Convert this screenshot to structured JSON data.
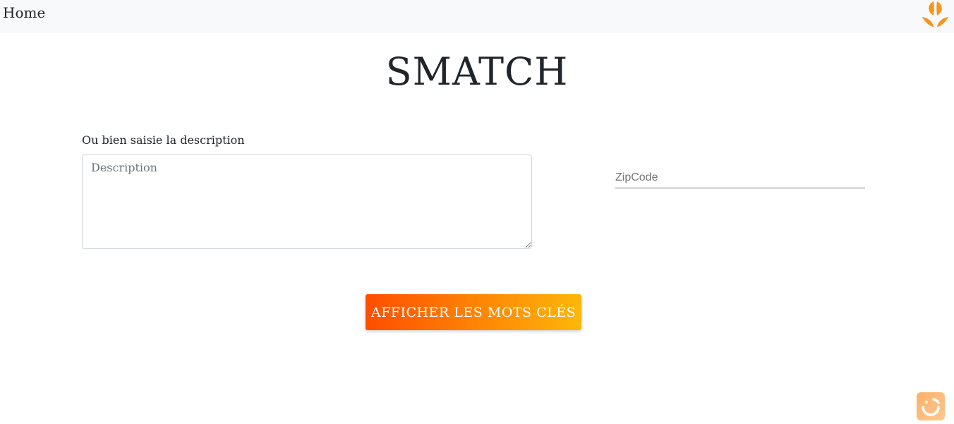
{
  "nav": {
    "home_label": "Home",
    "logo_icon": "orange-leaf-logo-icon"
  },
  "page": {
    "title": "SMATCH"
  },
  "form": {
    "description_label": "Ou bien saisie la description",
    "description_placeholder": "Description",
    "description_value": "",
    "zipcode_placeholder": "ZipCode",
    "zipcode_value": ""
  },
  "actions": {
    "show_keywords_label": "AFFICHER LES MOTS CLÉS"
  },
  "widget": {
    "icon": "chat-support-icon"
  },
  "colors": {
    "navbar_bg": "#f8f9fa",
    "button_gradient_start": "#ff4e00",
    "button_gradient_end": "#fdb70a",
    "logo_orange": "#f7941d",
    "widget_bg": "#fbb06a"
  }
}
